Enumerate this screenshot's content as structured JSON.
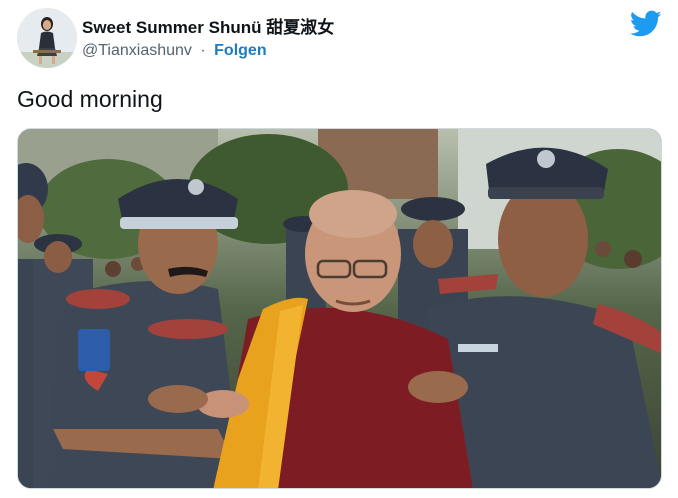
{
  "tweet": {
    "author": {
      "display_name": "Sweet Summer Shunü 甜夏淑女",
      "handle": "@Tianxiashunv",
      "separator": "·",
      "follow_label": "Folgen"
    },
    "text": "Good morning",
    "logo_icon": "twitter-bird-icon",
    "colors": {
      "accent": "#1d9bf0",
      "follow": "#1d7bc4",
      "text": "#0f1419",
      "secondary": "#536471"
    }
  }
}
